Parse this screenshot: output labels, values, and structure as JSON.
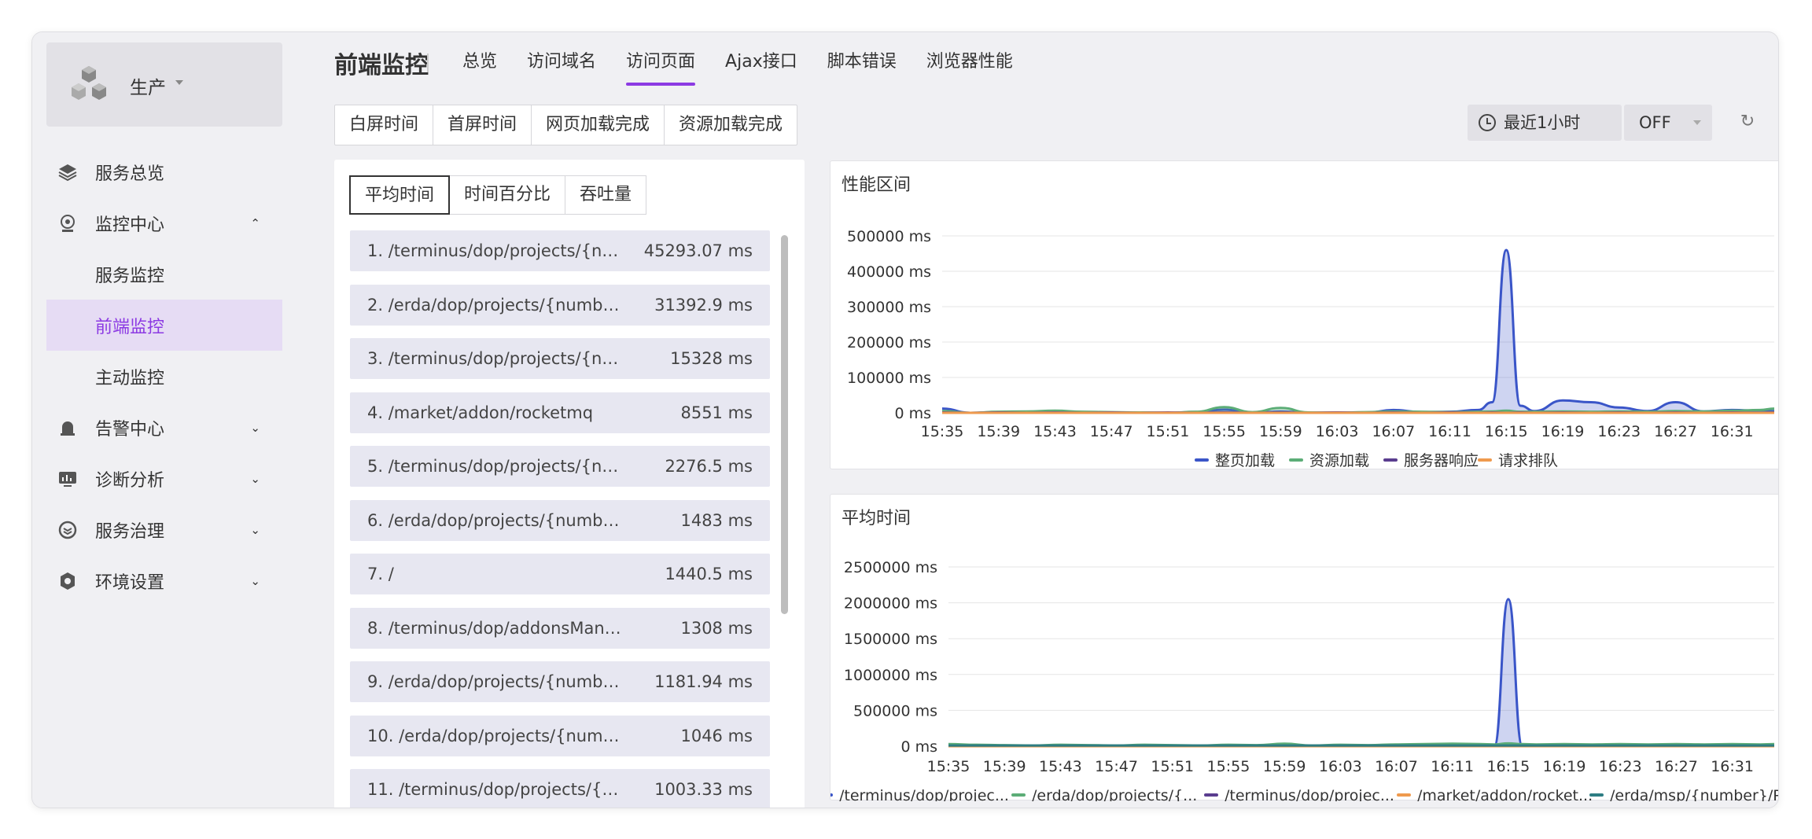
{
  "sidebar": {
    "env_label": "生产",
    "items": [
      {
        "label": "服务总览",
        "icon": "layers-icon"
      },
      {
        "label": "监控中心",
        "icon": "monitor-camera-icon"
      },
      {
        "label": "服务监控"
      },
      {
        "label": "前端监控"
      },
      {
        "label": "主动监控"
      },
      {
        "label": "告警中心",
        "icon": "alarm-bell-icon"
      },
      {
        "label": "诊断分析",
        "icon": "dashboard-icon"
      },
      {
        "label": "服务治理",
        "icon": "governance-icon"
      },
      {
        "label": "环境设置",
        "icon": "settings-gear-icon"
      }
    ]
  },
  "header": {
    "title": "前端监控",
    "tabs": [
      "总览",
      "访问域名",
      "访问页面",
      "Ajax接口",
      "脚本错误",
      "浏览器性能"
    ],
    "active_tab": "访问页面"
  },
  "metric_tabs": [
    "白屏时间",
    "首屏时间",
    "网页加载完成",
    "资源加载完成"
  ],
  "time_range": "最近1小时",
  "refresh_mode": "OFF",
  "list_tabs": [
    "平均时间",
    "时间百分比",
    "吞吐量"
  ],
  "pages": [
    {
      "name": "1. /terminus/dop/projects/{nu...",
      "value": "45293.07 ms"
    },
    {
      "name": "2. /erda/dop/projects/{number}...",
      "value": "31392.9 ms"
    },
    {
      "name": "3. /terminus/dop/projects/{numb...",
      "value": "15328 ms"
    },
    {
      "name": "4. /market/addon/rocketmq",
      "value": "8551 ms"
    },
    {
      "name": "5. /terminus/dop/projects/{num...",
      "value": "2276.5 ms"
    },
    {
      "name": "6. /erda/dop/projects/{number}/a...",
      "value": "1483 ms"
    },
    {
      "name": "7. /",
      "value": "1440.5 ms"
    },
    {
      "name": "8. /terminus/dop/addonsManage/...",
      "value": "1308 ms"
    },
    {
      "name": "9. /erda/dop/projects/{number}...",
      "value": "1181.94 ms"
    },
    {
      "name": "10. /erda/dop/projects/{number}/i...",
      "value": "1046 ms"
    },
    {
      "name": "11. /terminus/dop/projects/{nu...",
      "value": "1003.33 ms"
    }
  ],
  "chart_data": [
    {
      "type": "area",
      "title": "性能区间",
      "x": [
        "15:35",
        "15:37",
        "15:39",
        "15:41",
        "15:43",
        "15:45",
        "15:47",
        "15:49",
        "15:51",
        "15:53",
        "15:55",
        "15:57",
        "15:59",
        "16:01",
        "16:03",
        "16:05",
        "16:07",
        "16:09",
        "16:11",
        "16:13",
        "16:14",
        "16:15",
        "16:16",
        "16:17",
        "16:19",
        "16:21",
        "16:23",
        "16:25",
        "16:27",
        "16:29",
        "16:31",
        "16:33",
        "16:34"
      ],
      "ytick_labels": [
        "0 ms",
        "100000 ms",
        "200000 ms",
        "300000 ms",
        "400000 ms",
        "500000 ms"
      ],
      "xtick_labels": [
        "15:35",
        "15:39",
        "15:43",
        "15:47",
        "15:51",
        "15:55",
        "15:59",
        "16:03",
        "16:07",
        "16:11",
        "16:15",
        "16:19",
        "16:23",
        "16:27",
        "16:31"
      ],
      "ylim": [
        0,
        500000
      ],
      "legend_position": "bottom",
      "series": [
        {
          "name": "整页加载",
          "color": "#3a55c8",
          "values": [
            12000,
            0,
            2000,
            0,
            3000,
            2000,
            0,
            1000,
            0,
            2000,
            9000,
            0,
            4000,
            0,
            1000,
            0,
            8000,
            2000,
            3000,
            8000,
            30000,
            460000,
            20000,
            5000,
            35000,
            30000,
            15000,
            5000,
            30000,
            4000,
            8000,
            6000,
            5000
          ]
        },
        {
          "name": "资源加载",
          "color": "#5cad77",
          "values": [
            5000,
            0,
            3000,
            4000,
            6000,
            3000,
            2000,
            1000,
            0,
            3000,
            16000,
            2000,
            14000,
            1000,
            0,
            2000,
            4000,
            3000,
            2000,
            3000,
            4000,
            6000,
            3000,
            3000,
            4000,
            3000,
            4000,
            3000,
            5000,
            4000,
            6000,
            8000,
            12000
          ]
        },
        {
          "name": "服务器响应",
          "color": "#5a3d8f",
          "values": [
            1000,
            0,
            1000,
            0,
            1000,
            0,
            1000,
            0,
            1000,
            0,
            1000,
            0,
            1000,
            0,
            1000,
            0,
            1000,
            0,
            1000,
            0,
            1000,
            0,
            1000,
            0,
            1000,
            0,
            1000,
            0,
            1000,
            0,
            1000,
            0,
            1000
          ]
        },
        {
          "name": "请求排队",
          "color": "#ef9a4e",
          "values": [
            0,
            0,
            0,
            0,
            0,
            0,
            0,
            0,
            0,
            0,
            0,
            0,
            0,
            0,
            0,
            0,
            0,
            0,
            0,
            0,
            0,
            0,
            0,
            0,
            0,
            0,
            0,
            0,
            0,
            0,
            0,
            0,
            0
          ]
        }
      ]
    },
    {
      "type": "area",
      "title": "平均时间",
      "x": [
        "15:35",
        "15:37",
        "15:39",
        "15:41",
        "15:43",
        "15:45",
        "15:47",
        "15:49",
        "15:51",
        "15:53",
        "15:55",
        "15:57",
        "15:59",
        "16:01",
        "16:03",
        "16:05",
        "16:07",
        "16:09",
        "16:11",
        "16:13",
        "16:14",
        "16:15",
        "16:16",
        "16:17",
        "16:19",
        "16:21",
        "16:23",
        "16:25",
        "16:27",
        "16:29",
        "16:31",
        "16:33",
        "16:34"
      ],
      "ytick_labels": [
        "0 ms",
        "500000 ms",
        "1000000 ms",
        "1500000 ms",
        "2000000 ms",
        "2500000 ms"
      ],
      "xtick_labels": [
        "15:35",
        "15:39",
        "15:43",
        "15:47",
        "15:51",
        "15:55",
        "15:59",
        "16:03",
        "16:07",
        "16:11",
        "16:15",
        "16:19",
        "16:23",
        "16:27",
        "16:31"
      ],
      "ylim": [
        0,
        2500000
      ],
      "legend_position": "bottom",
      "series": [
        {
          "name": "/terminus/dop/projec...",
          "color": "#3a55c8",
          "values": [
            0,
            0,
            0,
            0,
            0,
            0,
            0,
            0,
            0,
            0,
            0,
            0,
            0,
            0,
            0,
            0,
            0,
            0,
            0,
            0,
            0,
            2050000,
            0,
            0,
            0,
            0,
            0,
            0,
            0,
            0,
            0,
            0,
            0
          ]
        },
        {
          "name": "/erda/dop/projects/{...",
          "color": "#5cad77",
          "values": [
            30000,
            20000,
            15000,
            10000,
            20000,
            15000,
            10000,
            20000,
            15000,
            10000,
            20000,
            15000,
            35000,
            10000,
            20000,
            15000,
            25000,
            30000,
            35000,
            30000,
            25000,
            40000,
            30000,
            25000,
            30000,
            25000,
            30000,
            25000,
            30000,
            25000,
            30000,
            25000,
            30000
          ]
        },
        {
          "name": "/terminus/dop/projec...",
          "color": "#5a3d8f",
          "values": [
            5000,
            5000,
            5000,
            5000,
            5000,
            5000,
            5000,
            5000,
            5000,
            5000,
            5000,
            5000,
            5000,
            5000,
            5000,
            5000,
            5000,
            5000,
            5000,
            5000,
            5000,
            5000,
            5000,
            5000,
            5000,
            5000,
            5000,
            5000,
            5000,
            5000,
            5000,
            5000,
            5000
          ]
        },
        {
          "name": "/market/addon/rocket...",
          "color": "#ef9a4e",
          "values": [
            0,
            0,
            0,
            0,
            0,
            0,
            0,
            0,
            0,
            0,
            0,
            0,
            0,
            0,
            0,
            0,
            0,
            0,
            0,
            0,
            0,
            0,
            0,
            0,
            0,
            0,
            0,
            0,
            0,
            0,
            0,
            0,
            0
          ]
        },
        {
          "name": "/erda/msp/{number}/P...",
          "color": "#2e7d83",
          "values": [
            10000,
            10000,
            10000,
            10000,
            10000,
            10000,
            10000,
            10000,
            10000,
            10000,
            10000,
            10000,
            10000,
            10000,
            10000,
            10000,
            10000,
            10000,
            10000,
            10000,
            10000,
            10000,
            10000,
            10000,
            10000,
            10000,
            10000,
            10000,
            10000,
            10000,
            10000,
            10000,
            10000
          ]
        }
      ]
    }
  ]
}
